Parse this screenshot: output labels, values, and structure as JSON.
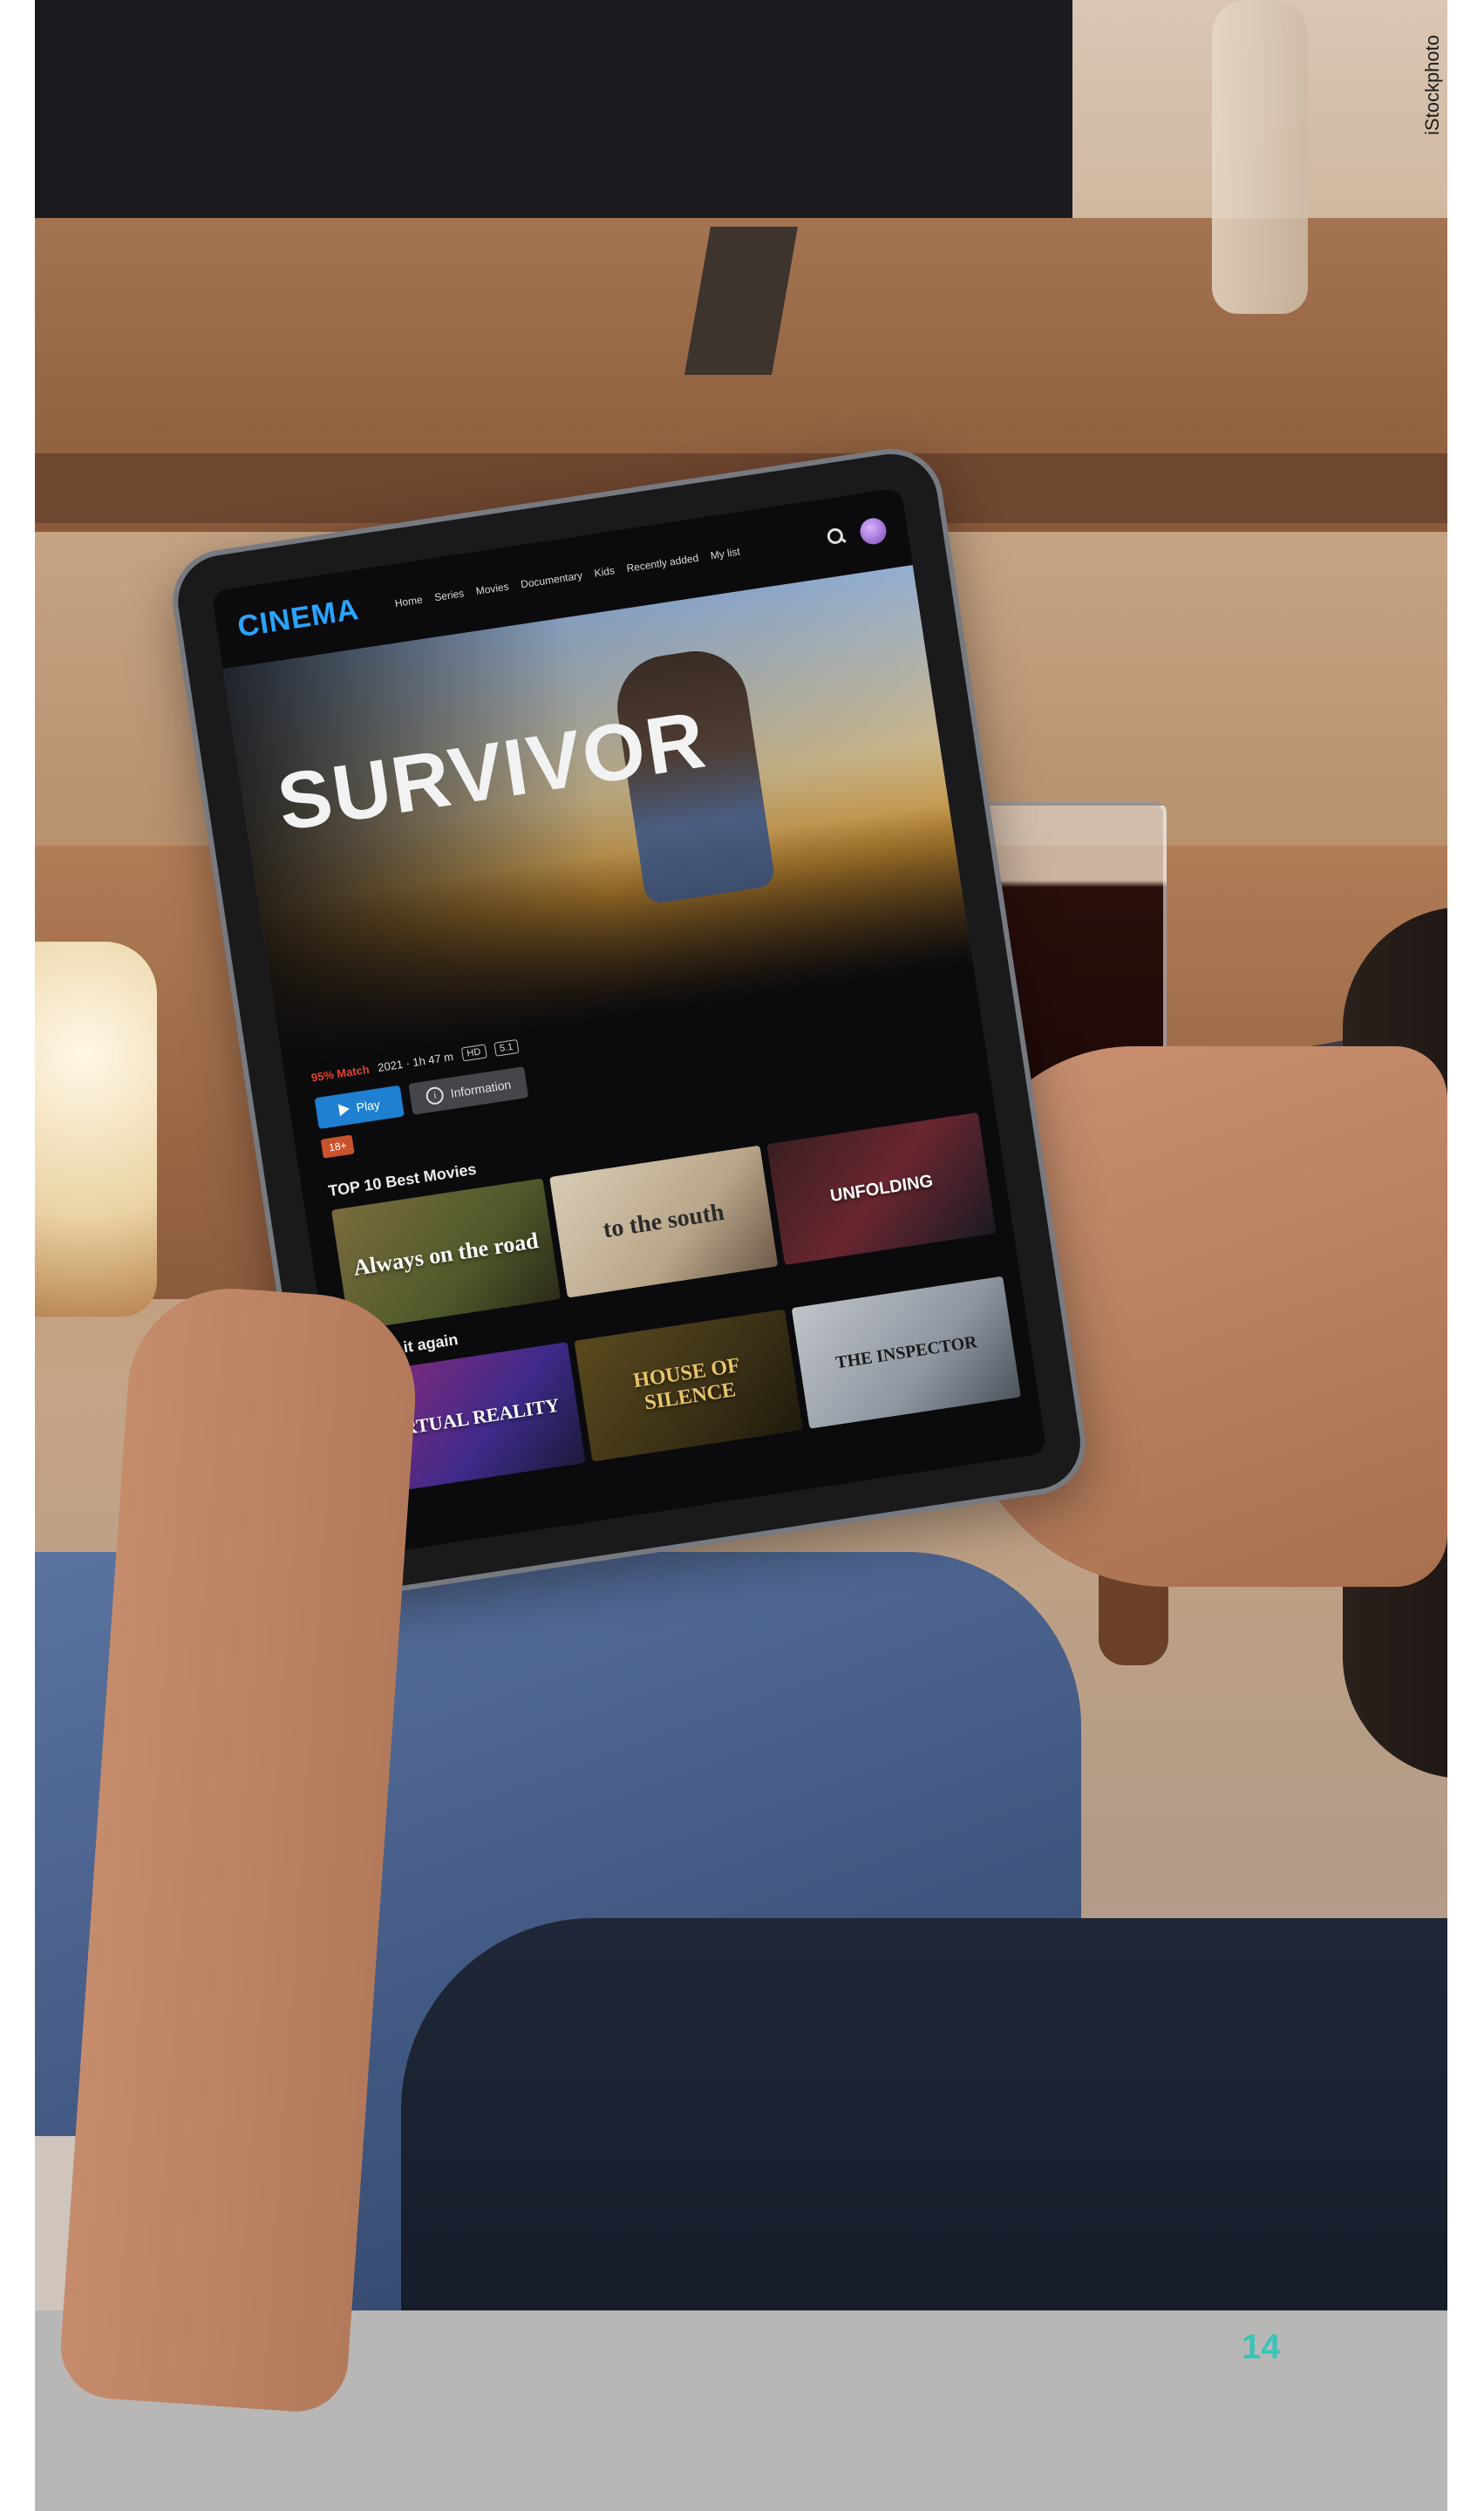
{
  "credit": "iStockphoto",
  "page_number": "14",
  "app": {
    "logo": "CINEMA",
    "nav": [
      "Home",
      "Series",
      "Movies",
      "Documentary",
      "Kids",
      "Recently added",
      "My list"
    ]
  },
  "hero": {
    "title": "SURVIVOR",
    "match": "95% Match",
    "year_runtime": "2021 · 1h 47 m",
    "hd": "HD",
    "audio": "5.1",
    "play_label": "Play",
    "info_label": "Information",
    "age_rating": "18+"
  },
  "rows": [
    {
      "title": "TOP 10 Best Movies",
      "cards": [
        "Always on the road",
        "to the south",
        "UNFOLDING"
      ]
    },
    {
      "title": "Watch it again",
      "cards": [
        "VIRTUAL REALITY",
        "HOUSE OF SILENCE",
        "THE INSPECTOR"
      ]
    }
  ]
}
